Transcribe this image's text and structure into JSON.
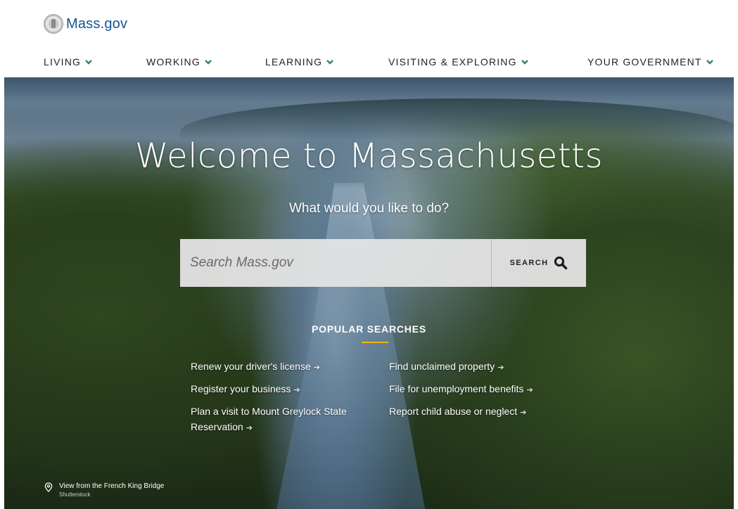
{
  "site": {
    "logo_text": "Mass.gov"
  },
  "nav": {
    "items": [
      {
        "label": "LIVING"
      },
      {
        "label": "WORKING"
      },
      {
        "label": "LEARNING"
      },
      {
        "label": "VISITING & EXPLORING"
      },
      {
        "label": "YOUR GOVERNMENT"
      }
    ]
  },
  "hero": {
    "title": "Welcome to Massachusetts",
    "subtitle": "What would you like to do?",
    "search": {
      "placeholder": "Search Mass.gov",
      "button_label": "SEARCH"
    },
    "popular": {
      "title": "POPULAR SEARCHES",
      "left": [
        "Renew your driver's license",
        "Register your business",
        "Plan a visit to Mount Greylock State Reservation"
      ],
      "right": [
        "Find unclaimed property",
        "File for unemployment benefits",
        "Report child abuse or neglect"
      ]
    },
    "credit": {
      "caption": "View from the French King Bridge",
      "source": "Shutterstock"
    }
  },
  "colors": {
    "brand_blue": "#14558f",
    "accent_green": "#388557",
    "accent_gold": "#f2b21c"
  },
  "icons": {
    "chevron": "chevron-down-icon",
    "search": "search-icon",
    "pin": "location-pin-icon",
    "seal": "state-seal-icon"
  }
}
